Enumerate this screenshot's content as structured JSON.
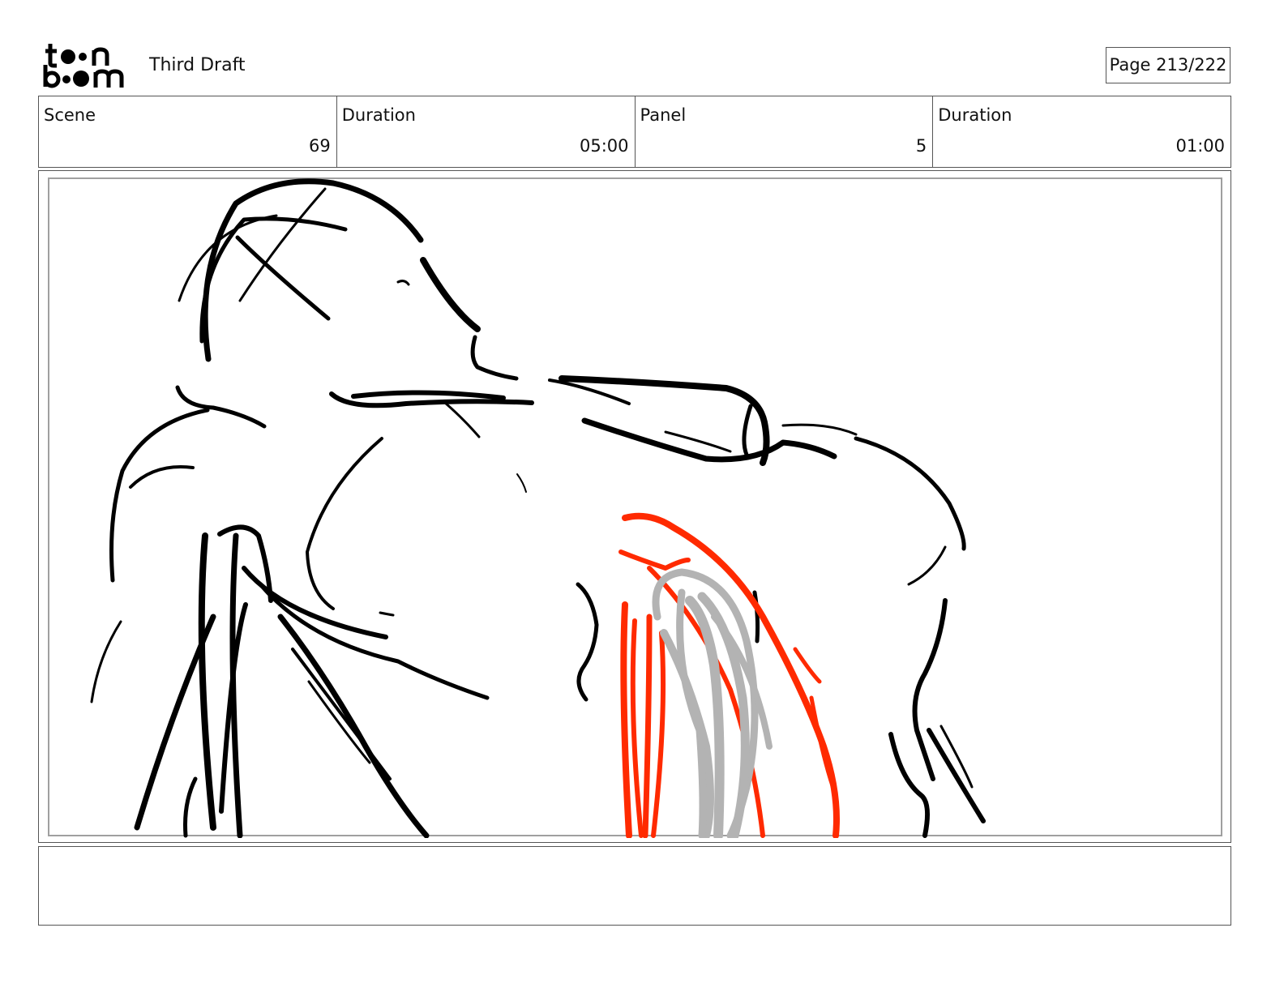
{
  "header": {
    "logo_alt": "toon boom",
    "title": "Third Draft",
    "page_label": "Page 213/222"
  },
  "info": [
    {
      "label": "Scene",
      "value": "69"
    },
    {
      "label": "Duration",
      "value": "05:00"
    },
    {
      "label": "Panel",
      "value": "5"
    },
    {
      "label": "Duration",
      "value": "01:00"
    }
  ],
  "notes": {
    "text": ""
  },
  "colors": {
    "sketch_black": "#000000",
    "sketch_red": "#ff2a00",
    "sketch_gray": "#b3b3b3",
    "frame_border": "#a0a0a0"
  }
}
